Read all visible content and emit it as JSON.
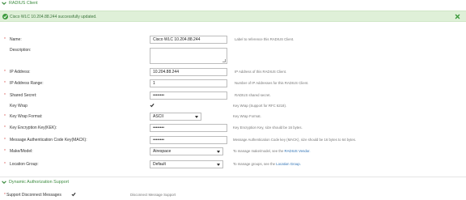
{
  "section_radius": {
    "title": "RADIUS Client"
  },
  "banner": {
    "message": "Cisco WLC 10.204.88.244 successfully updated."
  },
  "form": {
    "name": {
      "label": "Name:",
      "value": "Cisco WLC 10.204.88.244",
      "help": "Label to reference this RADIUS Client."
    },
    "description": {
      "label": "Description:",
      "value": ""
    },
    "ip_address": {
      "label": "IP Address:",
      "value": "10.204.88.244",
      "help": "IP Address of this RADIUS Client."
    },
    "ip_range": {
      "label": "IP Address Range:",
      "value": "1",
      "help": "Number of IP Addresses for this RADIUS Client."
    },
    "shared_secret": {
      "label": "Shared Secret:",
      "value": "••••••••",
      "help": "RADIUS shared secret."
    },
    "key_wrap": {
      "label": "Key Wrap",
      "checked": true,
      "help": "Key Wrap (Support for RFC 6218)."
    },
    "key_wrap_format": {
      "label": "Key Wrap Format:",
      "value": "ASCII",
      "help": "Key Wrap Format."
    },
    "kek": {
      "label": "Key Encryption Key(KEK):",
      "value": "••••••••",
      "help": "Key Encryption Key, size should be 16 bytes."
    },
    "mack": {
      "label": "Message Authentication Code Key(MACK):",
      "value": "••••••••",
      "help": "Message Authentication Code key (MACK), size should be 16 bytes to 64 bytes."
    },
    "make_model": {
      "label": "Make/Model:",
      "value": "Airespace",
      "help_prefix": "To manage make/model, see the",
      "help_link": "RADIUS Vendor."
    },
    "location_group": {
      "label": "Location Group:",
      "value": "Default",
      "help_prefix": "To manage groups, see the",
      "help_link": "Location Group."
    }
  },
  "section_dynamic": {
    "title": "Dynamic Authorization Support"
  },
  "support_disconnect": {
    "label": "Support Disconnect Messages",
    "checked": true,
    "help": "Disconnect Message Support"
  },
  "colors": {
    "accent_green": "#3d8c40",
    "banner_bg": "#dff0d8",
    "required": "#d9534f",
    "link": "#2a6fb3"
  }
}
